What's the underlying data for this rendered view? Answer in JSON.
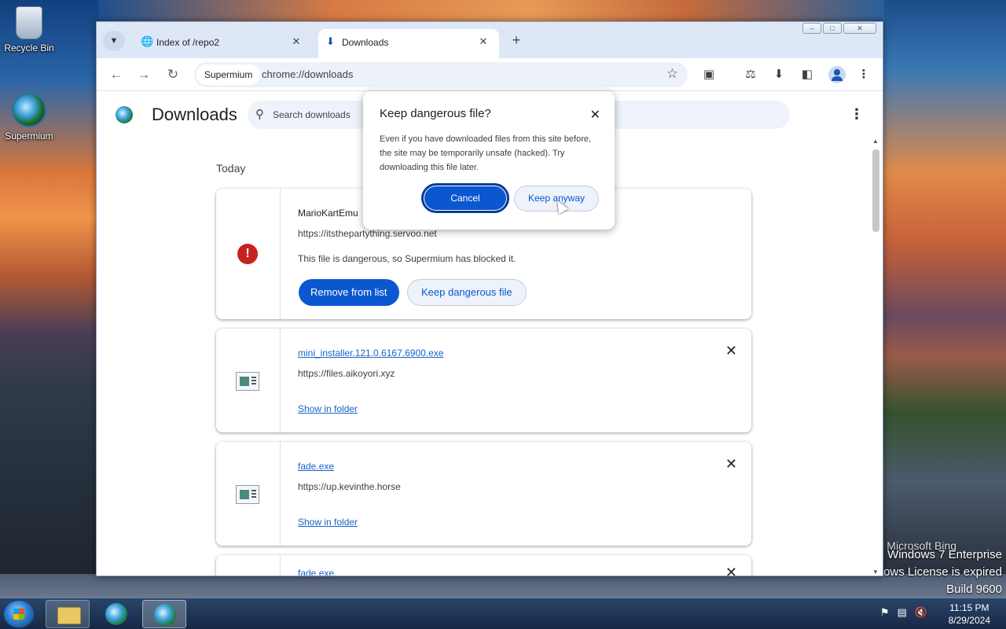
{
  "desktop": {
    "icons": [
      {
        "label": "Recycle Bin"
      },
      {
        "label": "Supermium"
      }
    ],
    "watermark": {
      "bing": "Microsoft Bing",
      "line1": "Windows 7 Enterprise",
      "line2": "dows License is expired",
      "line3": "Build 9600"
    }
  },
  "browser": {
    "tabs": [
      {
        "label": "Index of /repo2",
        "icon": "globe-icon"
      },
      {
        "label": "Downloads",
        "icon": "download-icon"
      }
    ],
    "omnibox": {
      "site_chip": "Supermium",
      "url": "chrome://downloads"
    }
  },
  "downloads_page": {
    "title": "Downloads",
    "search_placeholder": "Search downloads",
    "section_label": "Today",
    "items": [
      {
        "name": "MarioKartEmu",
        "url": "https://itsthepartything.servoo.net",
        "message": "This file is dangerous, so Supermium has blocked it.",
        "primary_action": "Remove from list",
        "secondary_action": "Keep dangerous file"
      },
      {
        "name": "mini_installer.121.0.6167.6900.exe",
        "url": "https://files.aikoyori.xyz",
        "action": "Show in folder"
      },
      {
        "name": "fade.exe",
        "url": "https://up.kevinthe.horse",
        "action": "Show in folder"
      },
      {
        "name": "fade.exe"
      }
    ]
  },
  "dialog": {
    "title": "Keep dangerous file?",
    "body": "Even if you have downloaded files from this site before, the site may be temporarily unsafe (hacked). Try downloading this file later.",
    "cancel_label": "Cancel",
    "keep_label": "Keep anyway"
  },
  "taskbar": {
    "time": "11:15 PM",
    "date": "8/29/2024"
  },
  "colors": {
    "accent": "#0b57d0",
    "danger": "#c5221f",
    "tabstrip": "#dee7f6"
  }
}
